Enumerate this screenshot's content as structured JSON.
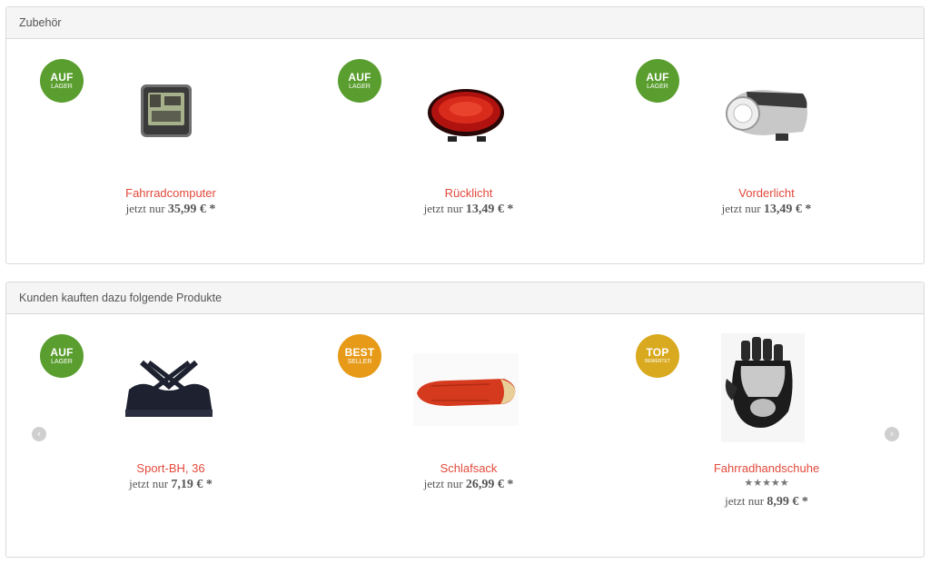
{
  "sections": [
    {
      "title": "Zubehör",
      "products": [
        {
          "badge": {
            "line1": "AUF",
            "line2": "LAGER",
            "color": "#5a9e2f"
          },
          "image_icon": "bike-computer-image",
          "name": "Fahrradcomputer",
          "price_prefix": "jetzt nur",
          "price": "35,99 € *"
        },
        {
          "badge": {
            "line1": "AUF",
            "line2": "LAGER",
            "color": "#5a9e2f"
          },
          "image_icon": "rear-light-image",
          "name": "Rücklicht",
          "price_prefix": "jetzt nur",
          "price": "13,49 € *"
        },
        {
          "badge": {
            "line1": "AUF",
            "line2": "LAGER",
            "color": "#5a9e2f"
          },
          "image_icon": "front-light-image",
          "name": "Vorderlicht",
          "price_prefix": "jetzt nur",
          "price": "13,49 € *"
        }
      ]
    },
    {
      "title": "Kunden kauften dazu folgende Produkte",
      "products": [
        {
          "badge": {
            "line1": "AUF",
            "line2": "LAGER",
            "color": "#5a9e2f"
          },
          "image_icon": "sports-bra-image",
          "name": "Sport-BH, 36",
          "price_prefix": "jetzt nur",
          "price": "7,19 € *"
        },
        {
          "badge": {
            "line1": "BEST",
            "line2": "SELLER",
            "color": "#e69a17"
          },
          "image_icon": "sleeping-bag-image",
          "name": "Schlafsack",
          "price_prefix": "jetzt nur",
          "price": "26,99 € *"
        },
        {
          "badge": {
            "line1": "TOP",
            "line2": "BEWERTET",
            "color": "#d9aa1f"
          },
          "image_icon": "cycling-gloves-image",
          "name": "Fahrradhandschuhe",
          "rating": 5,
          "stars": "★★★★★",
          "price_prefix": "jetzt nur",
          "price": "8,99 € *"
        }
      ],
      "nav": {
        "prev_icon": "chevron-left-icon",
        "next_icon": "chevron-right-icon"
      }
    }
  ]
}
